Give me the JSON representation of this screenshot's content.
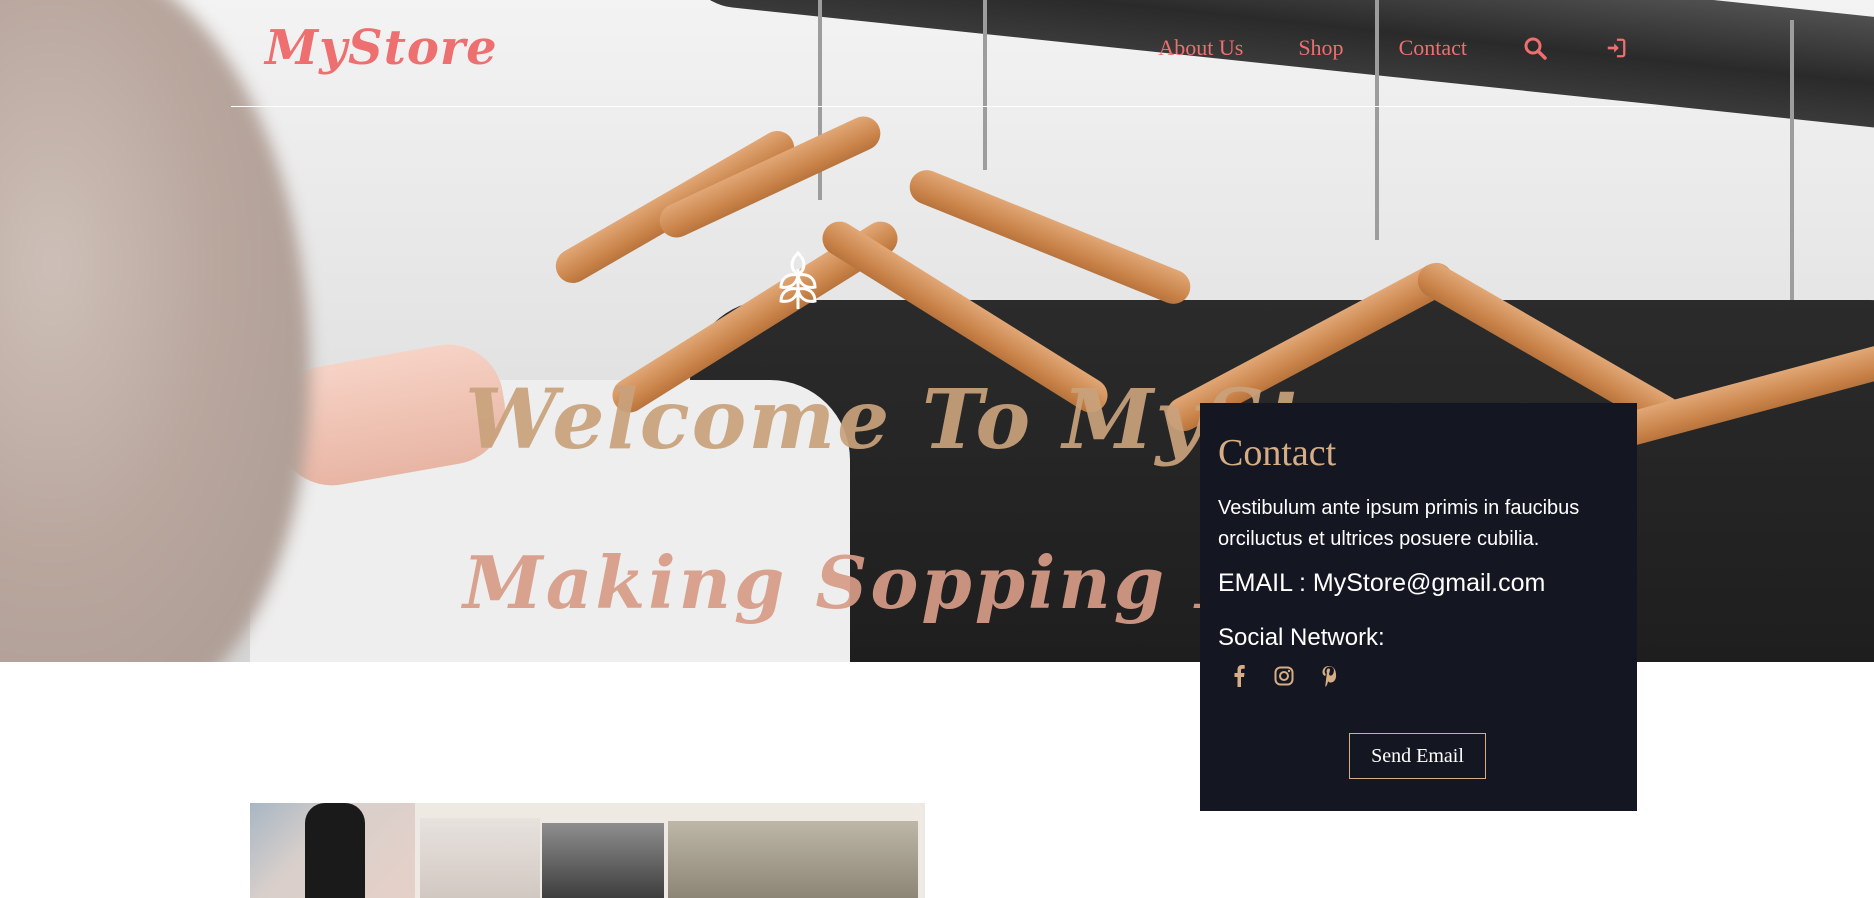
{
  "header": {
    "logo": "MyStore",
    "nav": [
      {
        "label": "About Us"
      },
      {
        "label": "Shop"
      },
      {
        "label": "Contact"
      }
    ],
    "icons": [
      "search-icon",
      "sign-in-icon"
    ]
  },
  "hero": {
    "title": "Welcome To MyStore",
    "subtitle": "Making Sopping Better",
    "brand_icon": "wheat-leaf-icon"
  },
  "contact": {
    "heading": "Contact",
    "description": "Vestibulum ante ipsum primis in faucibus orciluctus et ultrices posuere cubilia.",
    "email": "EMAIL : MyStore@gmail.com",
    "social_heading": "Social Network:",
    "social_icons": [
      "facebook-icon",
      "instagram-icon",
      "pinterest-icon"
    ],
    "send_button": "Send Email"
  },
  "colors": {
    "brand": "#ee6f6f",
    "accent_gold": "#d6ad84",
    "panel_bg": "#141722"
  }
}
